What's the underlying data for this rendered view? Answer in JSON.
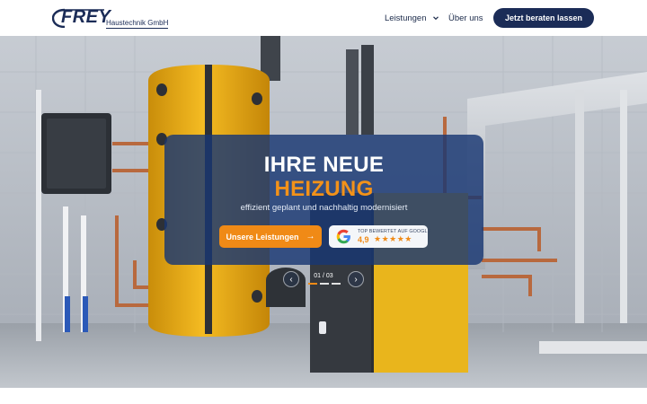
{
  "header": {
    "logo_name": "FREY",
    "logo_sub": "Haustechnik GmbH",
    "nav": {
      "leistungen": "Leistungen",
      "ueber_uns": "Über uns"
    },
    "cta": "Jetzt beraten lassen"
  },
  "hero": {
    "title_line1": "IHRE NEUE",
    "title_line2": "HEIZUNG",
    "subtitle": "effizient geplant und nachhaltig modernisiert",
    "primary_button": "Unsere Leistungen",
    "primary_button_icon": "arrow-right-icon",
    "google_badge": {
      "label": "TOP BEWERTET AUF GOOGLE",
      "rating": "4,9",
      "stars": 5
    },
    "slider": {
      "counter": "01 / 03",
      "current": 1,
      "total": 3
    }
  },
  "colors": {
    "brand_navy": "#1b2c57",
    "accent_orange": "#f08a16",
    "overlay_blue": "#19376f"
  }
}
